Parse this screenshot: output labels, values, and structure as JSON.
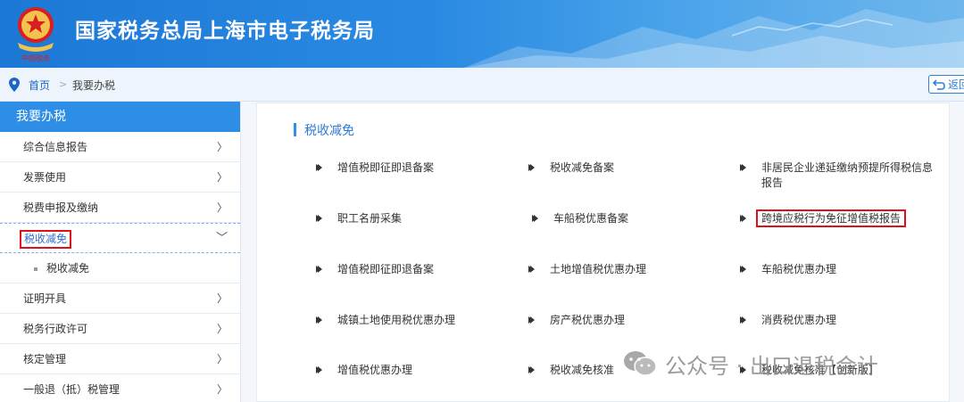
{
  "header": {
    "title": "国家税务总局上海市电子税务局"
  },
  "breadcrumb": {
    "home": "首页",
    "separator": ">",
    "current": "我要办税"
  },
  "back_button": {
    "label": "返回"
  },
  "sidebar": {
    "title": "我要办税",
    "items": [
      {
        "label": "综合信息报告",
        "chevron": "〉"
      },
      {
        "label": "发票使用",
        "chevron": "〉"
      },
      {
        "label": "税费申报及缴纳",
        "chevron": "〉"
      },
      {
        "label": "税收减免",
        "chevron": "﹀",
        "active": true
      },
      {
        "label": "证明开具",
        "chevron": "〉"
      },
      {
        "label": "税务行政许可",
        "chevron": "〉"
      },
      {
        "label": "核定管理",
        "chevron": "〉"
      },
      {
        "label": "一般退（抵）税管理",
        "chevron": "〉"
      }
    ],
    "sub_item": {
      "label": "税收减免"
    }
  },
  "main": {
    "section_title": "税收减免",
    "services": [
      "增值税即征即退备案",
      "税收减免备案",
      "非居民企业递延缴纳预提所得税信息报告",
      "职工名册采集",
      "车船税优惠备案",
      "跨境应税行为免征增值税报告",
      "增值税即征即退备案",
      "土地增值税优惠办理",
      "车船税优惠办理",
      "城镇土地使用税优惠办理",
      "房产税优惠办理",
      "消费税优惠办理",
      "增值税优惠办理",
      "税收减免核准",
      "税收减免核准【创新版】"
    ],
    "highlighted_service": "跨境应税行为免征增值税报告"
  },
  "watermark": {
    "text": "公众号 · 出口退税会计"
  },
  "colors": {
    "header_blue": "#1c78d6",
    "accent_blue": "#2e8ee6",
    "highlight_red": "#e0101a"
  }
}
